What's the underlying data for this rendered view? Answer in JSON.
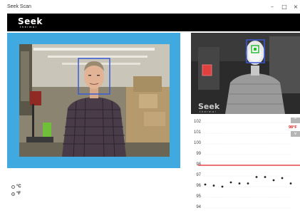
{
  "window": {
    "title": "Seek Scan",
    "minimize_glyph": "–",
    "maximize_glyph": "□",
    "close_glyph": "×"
  },
  "brand": {
    "logo_text": "Seek",
    "logo_subtext": "thermal"
  },
  "thermal": {
    "logo_text": "Seek",
    "logo_subtext": "thermal"
  },
  "units": {
    "options": [
      {
        "label": "°C",
        "selected": false
      },
      {
        "label": "°F",
        "selected": true
      }
    ]
  },
  "graph": {
    "ticks": [
      "102",
      "101",
      "100",
      "99",
      "98",
      "97",
      "96",
      "95",
      "94"
    ],
    "threshold_label": "98°F",
    "up_glyph": "^",
    "down_glyph": "v"
  },
  "colors": {
    "panel_blue": "#3fa9e0",
    "brand_bar": "#000000",
    "threshold_red": "#e02020",
    "face_box_blue": "#3b5bd8",
    "thermal_marker_green": "#2ebd3a",
    "thermal_marker_red": "#e04040"
  },
  "chart_data": {
    "type": "scatter",
    "title": "",
    "xlabel": "",
    "ylabel": "",
    "ylim": [
      94,
      102
    ],
    "threshold": 98,
    "series": [
      {
        "values": [
          96.2,
          96.1,
          96.0,
          96.4,
          96.3,
          96.3,
          96.9,
          96.9,
          96.6,
          96.8,
          96.3
        ]
      }
    ]
  }
}
